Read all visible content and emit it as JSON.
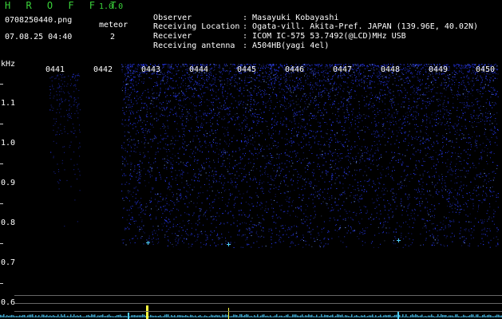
{
  "header": {
    "app_title": "H R O F F T",
    "app_version": "1.0.0",
    "file_name": "0708250440.png",
    "datetime": "07.08.25 04:40",
    "meteor_label": "meteor",
    "meteor_count": "2"
  },
  "info": [
    {
      "label": "Observer",
      "value": "Masayuki Kobayashi"
    },
    {
      "label": "Receiving Location",
      "value": "Ogata-vill. Akita-Pref. JAPAN (139.96E, 40.02N)"
    },
    {
      "label": "Receiver",
      "value": "ICOM IC-575 53.7492(@LCD)MHz USB"
    },
    {
      "label": "Receiving antenna",
      "value": "A504HB(yagi 4el)"
    }
  ],
  "spectrogram": {
    "y_unit": "kHz",
    "y_ticks": [
      "1.1",
      "1.0",
      "0.9",
      "0.8",
      "0.7",
      "0.6"
    ],
    "time_labels": [
      "0441",
      "0442",
      "0443",
      "0444",
      "0445",
      "0446",
      "0447",
      "0448",
      "0449",
      "0450"
    ],
    "colors": {
      "noise": "#2a3cff",
      "echo": "#4fd0ff",
      "trace": "#ffff40"
    }
  }
}
